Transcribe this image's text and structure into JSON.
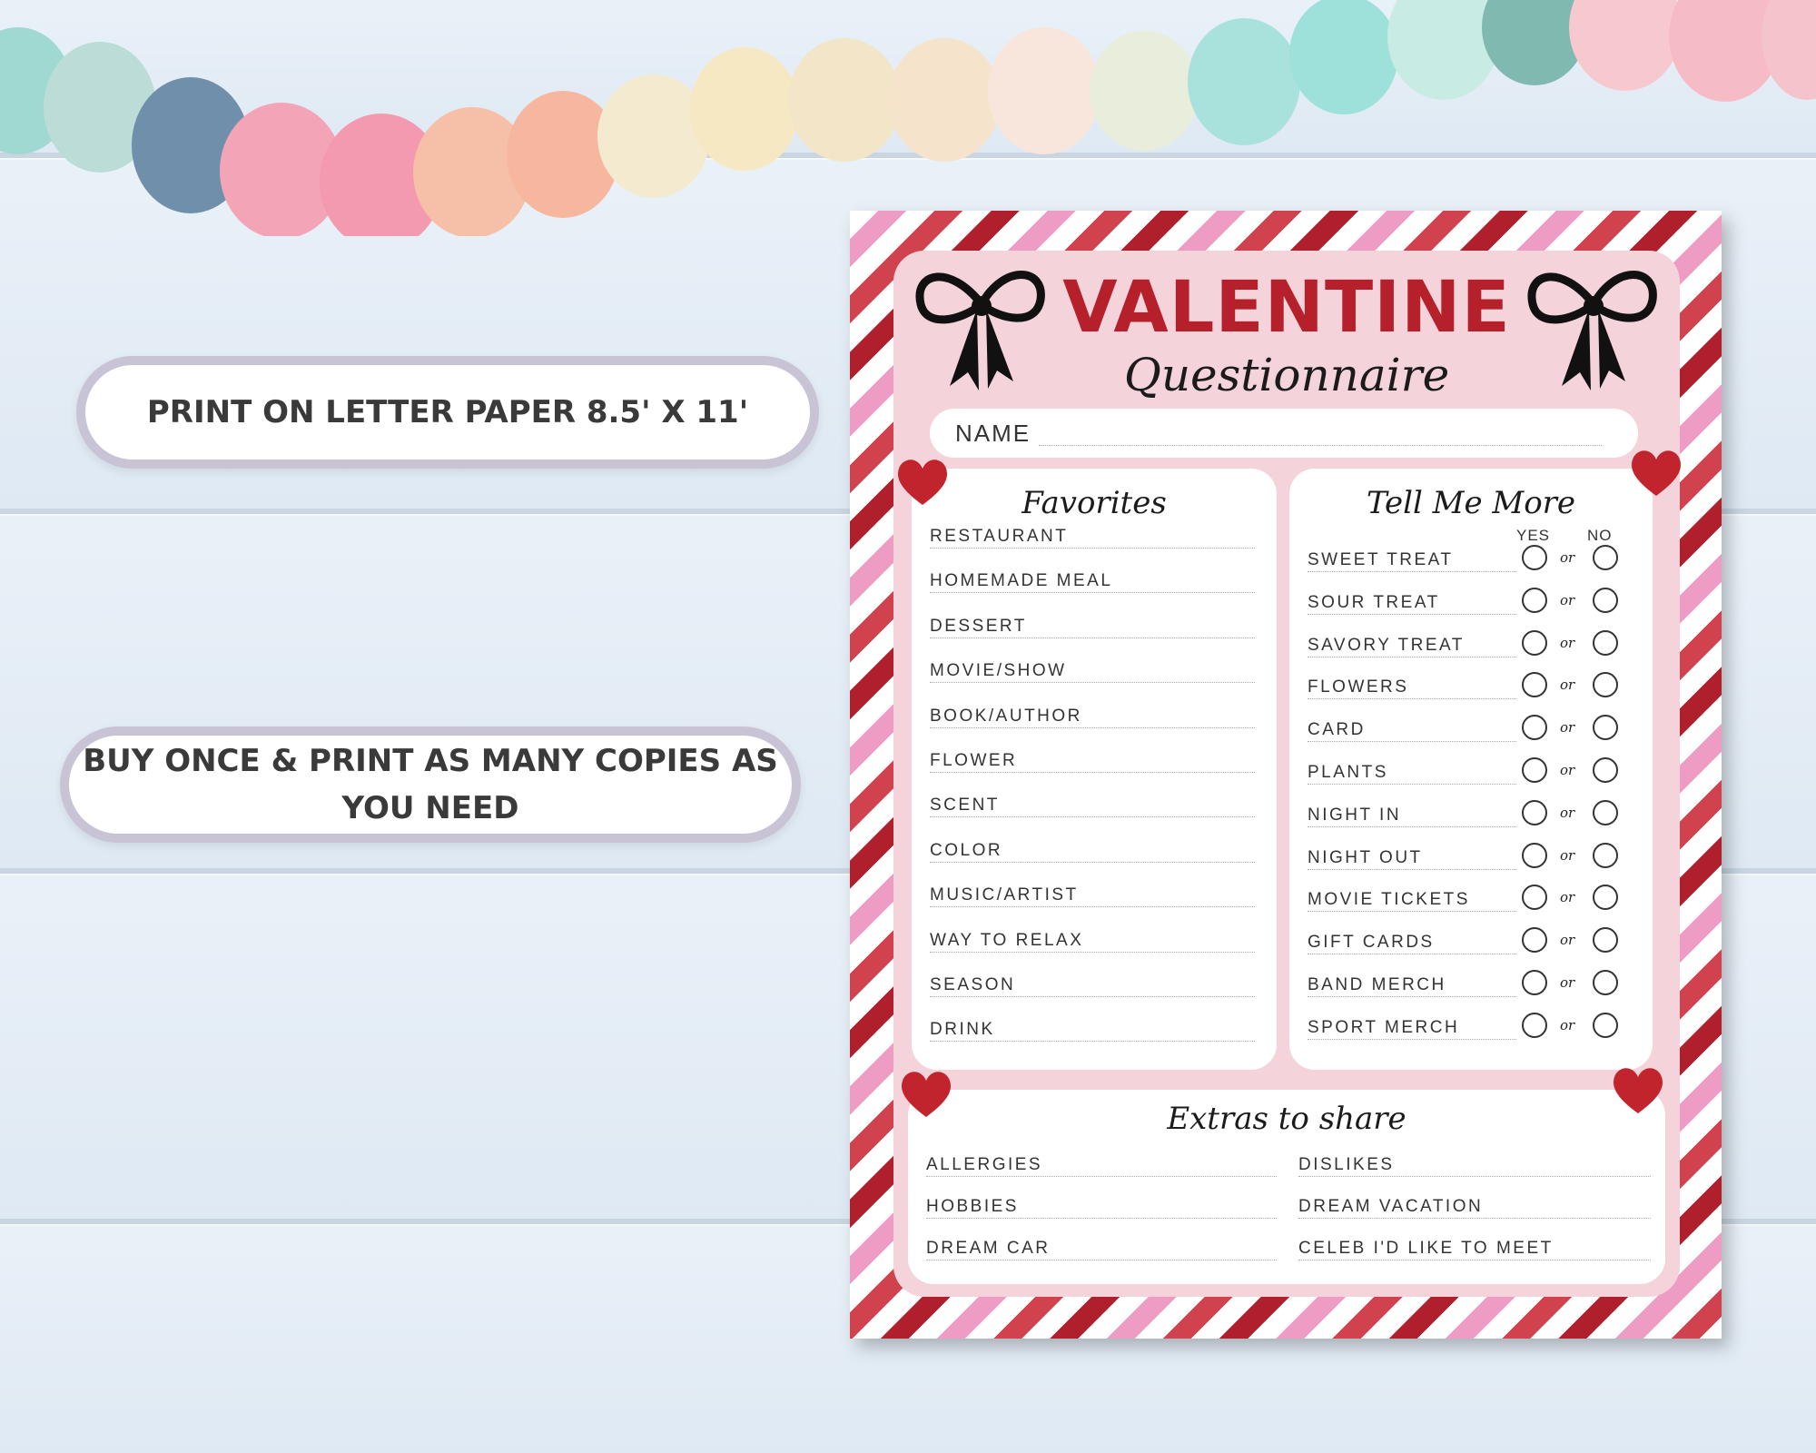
{
  "badges": {
    "print_size": "PRINT ON LETTER PAPER 8.5' X 11'",
    "buy_once_line1": "BUY ONCE & PRINT AS MANY COPIES AS",
    "buy_once_line2": "YOU NEED"
  },
  "sheet": {
    "title": "VALENTINE",
    "subtitle": "Questionnaire",
    "name_label": "NAME",
    "favorites": {
      "title": "Favorites",
      "items": [
        "RESTAURANT",
        "HOMEMADE MEAL",
        "DESSERT",
        "MOVIE/SHOW",
        "BOOK/AUTHOR",
        "FLOWER",
        "SCENT",
        "COLOR",
        "MUSIC/ARTIST",
        "WAY TO RELAX",
        "SEASON",
        "DRINK"
      ]
    },
    "tell_me_more": {
      "title": "Tell Me More",
      "yes_label": "YES",
      "no_label": "NO",
      "or_label": "or",
      "items": [
        "SWEET TREAT",
        "SOUR TREAT",
        "SAVORY TREAT",
        "FLOWERS",
        "CARD",
        "PLANTS",
        "NIGHT IN",
        "NIGHT OUT",
        "MOVIE TICKETS",
        "GIFT CARDS",
        "BAND MERCH",
        "SPORT MERCH"
      ]
    },
    "extras": {
      "title": "Extras to share",
      "left": [
        "ALLERGIES",
        "HOBBIES",
        "DREAM CAR"
      ],
      "right": [
        "DISLIKES",
        "DREAM VACATION",
        "CELEB I'D LIKE TO MEET"
      ]
    }
  },
  "colors": {
    "title_red": "#b5202b",
    "heart_red": "#c2242d",
    "panel_pink": "#f4d3da",
    "badge_border": "#c9c3d6"
  }
}
